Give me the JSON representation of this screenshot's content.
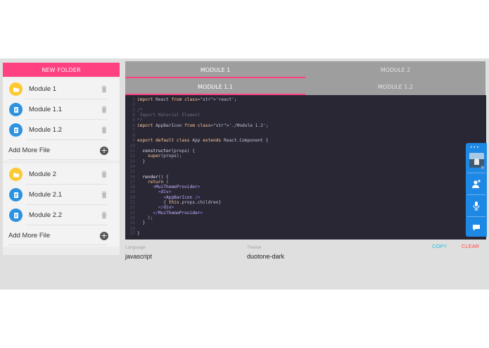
{
  "sidebar": {
    "new_folder_label": "NEW FOLDER",
    "folders": [
      {
        "name": "Module 1",
        "files": [
          "Module 1.1",
          "Module 1.2"
        ],
        "add_label": "Add More File"
      },
      {
        "name": "Module 2",
        "files": [
          "Module 2.1",
          "Module 2.2"
        ],
        "add_label": "Add More File"
      }
    ]
  },
  "tabs": {
    "modules": [
      "MODULE 1",
      "MODULE 2"
    ],
    "active_module": "MODULE 1",
    "files": [
      "MODULE 1.1",
      "MODULE 1.2"
    ],
    "active_file": "MODULE 1.1"
  },
  "editor": {
    "lines": [
      "import React from 'react';",
      "",
      "/*",
      " Import Material Element",
      "*/",
      "import AppBarIcon from './Module 1.2';",
      "",
      "",
      "export default class App extends React.Component {",
      "",
      "  constructor(props) {",
      "    super(props);",
      "  }",
      "",
      "",
      "  render() {",
      "    return (",
      "      <MuiThemeProvider>",
      "        <div>",
      "          <AppBarIcon />",
      "          { this.props.children}",
      "        </div>",
      "      </MuiThemeProvider>",
      "    );",
      "  }",
      "",
      "}"
    ]
  },
  "controls": {
    "language_label": "Language",
    "language_value": "javascript",
    "theme_label": "Theme",
    "theme_value": "duotone-dark",
    "copy_label": "COPY",
    "clear_label": "CLEAR"
  },
  "float_panel": {
    "menu_dots": "•••",
    "icons": [
      "avatar",
      "add-person-icon",
      "microphone-icon",
      "chat-icon"
    ]
  },
  "colors": {
    "accent": "#ff4081",
    "editor_bg": "#2a2734",
    "folder_icon": "#fcc933",
    "file_icon": "#2d92e0",
    "panel_blue": "#1e88e5",
    "copy": "#2bbbd8",
    "clear": "#ff4b4b"
  }
}
